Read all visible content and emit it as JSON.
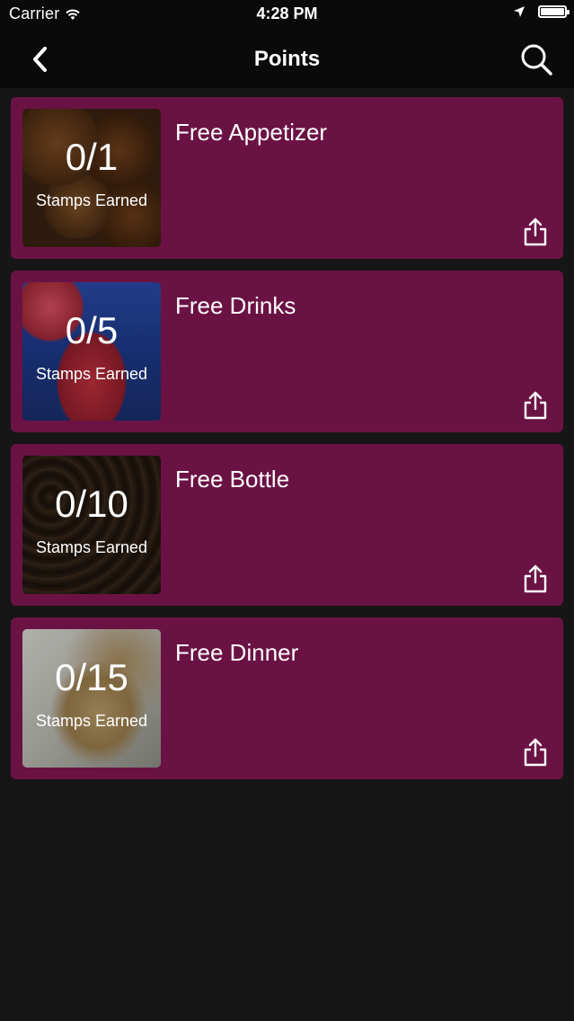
{
  "status_bar": {
    "carrier": "Carrier",
    "time": "4:28 PM",
    "battery_level": 1.0
  },
  "nav": {
    "title": "Points",
    "back_icon": "chevron-left-icon",
    "search_icon": "search-icon"
  },
  "colors": {
    "card_background": "#6b1245",
    "page_background": "#161616",
    "bar_background": "#0a0a0a"
  },
  "rewards": [
    {
      "title": "Free Appetizer",
      "count": "0/1",
      "caption": "Stamps Earned"
    },
    {
      "title": "Free Drinks",
      "count": "0/5",
      "caption": "Stamps Earned"
    },
    {
      "title": "Free Bottle",
      "count": "0/10",
      "caption": "Stamps Earned"
    },
    {
      "title": "Free Dinner",
      "count": "0/15",
      "caption": "Stamps Earned"
    }
  ]
}
